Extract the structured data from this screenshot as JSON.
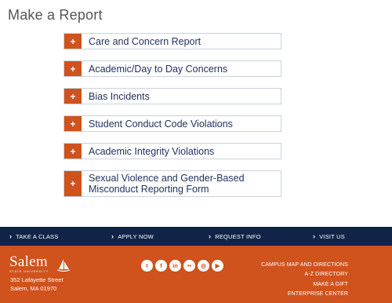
{
  "page": {
    "title": "Make a Report"
  },
  "accordion": {
    "expand_glyph": "+",
    "items": [
      {
        "label": "Care and Concern Report"
      },
      {
        "label": "Academic/Day to Day Concerns"
      },
      {
        "label": "Bias Incidents"
      },
      {
        "label": "Student Conduct Code Violations"
      },
      {
        "label": "Academic Integrity Violations"
      },
      {
        "label": "Sexual Violence and Gender-Based Misconduct Reporting Form"
      }
    ]
  },
  "quicklinks": [
    {
      "label": "TAKE A CLASS"
    },
    {
      "label": "APPLY NOW"
    },
    {
      "label": "REQUEST INFO"
    },
    {
      "label": "VISIT US"
    }
  ],
  "footer": {
    "logo_text": "Salem",
    "logo_subtext": "STATE UNIVERSITY",
    "address_line1": "352 Lafayette Street",
    "address_line2": "Salem, MA 01970",
    "social": [
      {
        "icon": "twitter-icon",
        "glyph": "t"
      },
      {
        "icon": "facebook-icon",
        "glyph": "f"
      },
      {
        "icon": "linkedin-icon",
        "glyph": "in"
      },
      {
        "icon": "flickr-icon",
        "glyph": "••"
      },
      {
        "icon": "instagram-icon",
        "glyph": "◎"
      },
      {
        "icon": "youtube-icon",
        "glyph": "▶"
      }
    ],
    "links": [
      {
        "label": "CAMPUS MAP AND DIRECTIONS"
      },
      {
        "label": "A-Z DIRECTORY"
      },
      {
        "label": "MAKE A GIFT"
      },
      {
        "label": "ENTERPRISE CENTER"
      }
    ]
  },
  "colors": {
    "accent": "#d0521c",
    "navy": "#0f2448",
    "title_text": "#555555",
    "item_text": "#1f2f5c",
    "item_border": "#c9d3e0"
  }
}
